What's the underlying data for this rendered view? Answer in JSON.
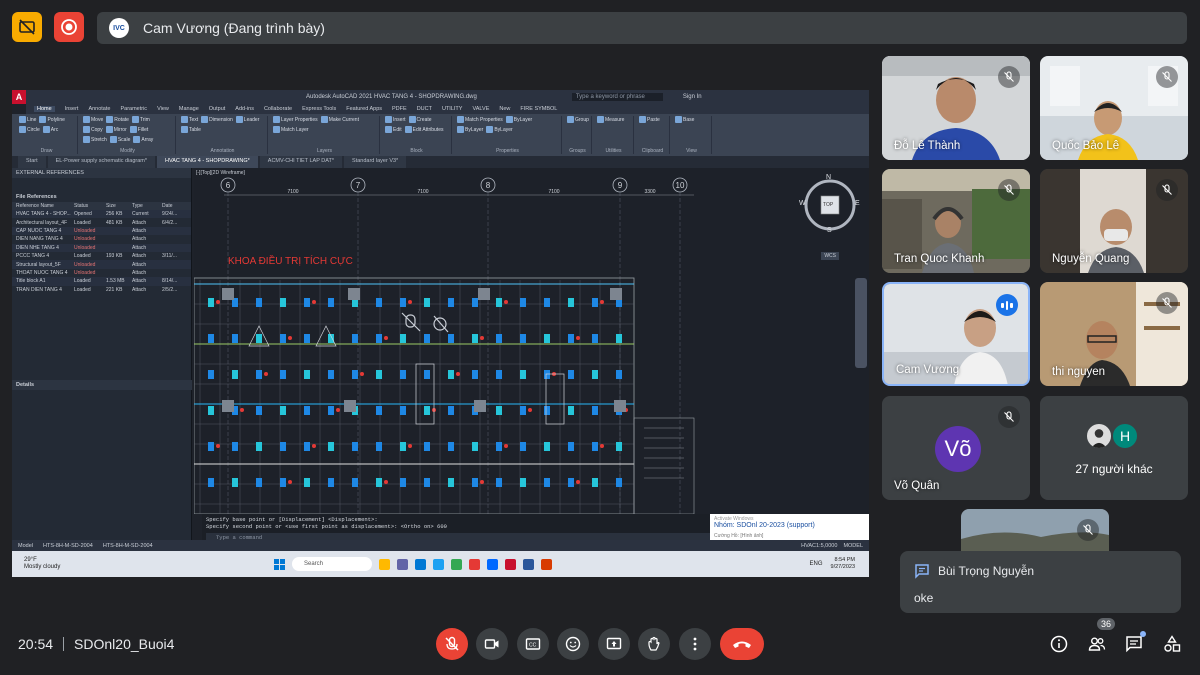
{
  "top": {
    "presenter_initials": "IVC",
    "presenter_text": "Cam Vương (Đang trình bày)"
  },
  "screen": {
    "acad_title": "Autodesk AutoCAD 2021   HVAC TANG 4 - SHOPDRAWING.dwg",
    "acad_search": "Type a keyword or phrase",
    "acad_signin": "Sign In",
    "menu_tabs": [
      "Home",
      "Insert",
      "Annotate",
      "Parametric",
      "View",
      "Manage",
      "Output",
      "Add-ins",
      "Collaborate",
      "Express Tools",
      "Featured Apps",
      "PDFE",
      "DUCT",
      "UTILITY",
      "VALVE",
      "New",
      "FIRE SYMBOL"
    ],
    "ribbon_groups": [
      {
        "label": "Draw",
        "tools": [
          "Line",
          "Polyline",
          "Circle",
          "Arc"
        ]
      },
      {
        "label": "Modify",
        "tools": [
          "Move",
          "Rotate",
          "Trim",
          "Copy",
          "Mirror",
          "Fillet",
          "Stretch",
          "Scale",
          "Array"
        ]
      },
      {
        "label": "Annotation",
        "tools": [
          "Text",
          "Dimension",
          "Leader",
          "Table"
        ]
      },
      {
        "label": "Layers",
        "tools": [
          "Layer Properties",
          "Make Current",
          "Match Layer"
        ]
      },
      {
        "label": "Block",
        "tools": [
          "Insert",
          "Create",
          "Edit",
          "Edit Attributes"
        ]
      },
      {
        "label": "Properties",
        "tools": [
          "Match Properties",
          "ByLayer",
          "ByLayer",
          "ByLayer"
        ]
      },
      {
        "label": "Groups",
        "tools": [
          "Group"
        ]
      },
      {
        "label": "Utilities",
        "tools": [
          "Measure"
        ]
      },
      {
        "label": "Clipboard",
        "tools": [
          "Paste"
        ]
      },
      {
        "label": "View",
        "tools": [
          "Base"
        ]
      }
    ],
    "file_tabs": [
      "Start",
      "EL-Power supply schematic diagram*",
      "HVAC TANG 4 - SHOPDRAWING*",
      "ACMV-CHI TIET LAP DAT*",
      "Standard layer V3*"
    ],
    "xref_title": "EXTERNAL REFERENCES",
    "xref_subtitle": "File References",
    "xref_columns": [
      "Reference Name",
      "Status",
      "Size",
      "Type",
      "Date"
    ],
    "xref_rows": [
      [
        "HVAC TANG 4 - SHOP...",
        "Opened",
        "256 KB",
        "Current",
        "9/24/..."
      ],
      [
        "Architectural layout_4F",
        "Loaded",
        "481 KB",
        "Attach",
        "6/4/2..."
      ],
      [
        "CAP NUOC TANG 4",
        "Unloaded",
        "",
        "Attach",
        ""
      ],
      [
        "DIEN NANG TANG 4",
        "Unloaded",
        "",
        "Attach",
        ""
      ],
      [
        "DIEN NHE TANG 4",
        "Unloaded",
        "",
        "Attach",
        ""
      ],
      [
        "PCCC TANG 4",
        "Loaded",
        "193 KB",
        "Attach",
        "3/11/..."
      ],
      [
        "Structural layout_5F",
        "Unloaded",
        "",
        "Attach",
        ""
      ],
      [
        "THOAT NUOC TANG 4",
        "Unloaded",
        "",
        "Attach",
        ""
      ],
      [
        "Title block A1",
        "Loaded",
        "1.53 MB",
        "Attach",
        "8/14/..."
      ],
      [
        "TRAN DIEN TANG 4",
        "Loaded",
        "221 KB",
        "Attach",
        "2/5/2..."
      ]
    ],
    "details_title": "Details",
    "viewport_label": "[-][Top][2D Wireframe]",
    "grid_numbers": [
      "6",
      "7",
      "8",
      "9",
      "10"
    ],
    "dims": [
      "7100",
      "7100",
      "7100",
      "3300"
    ],
    "red_text": "KHOA ĐIỀU TRỊ TÍCH CỰC",
    "viewcube": {
      "n": "N",
      "e": "E",
      "s": "S",
      "w": "W",
      "top": "TOP",
      "wcs": "WCS"
    },
    "cmd_line1": "Specify base point or [Displacement] <Displacement>:",
    "cmd_line2": "Specify second point or <use first point as displacement>:  <Ortho on> 600",
    "cmd_placeholder": "Type a command",
    "notif_watermark": "Activate Windows",
    "notif_title": "Nhóm: SDOnl 20-2023 (support)",
    "notif_sub": "Cường Hồ: [Hình ảnh]",
    "status_tabs": [
      "Model",
      "HTS-8H-M-SD-2004",
      "HTS-8H-M-SD-2004"
    ],
    "status_scale": "HVAC1:5,0000",
    "status_model": "MODEL",
    "weather_temp": "29°F",
    "weather_text": "Mostly cloudy",
    "search_text": "Search",
    "lang": "ENG",
    "clock_time": "8:54 PM",
    "clock_date": "9/27/2023"
  },
  "participants": [
    {
      "name": "Đỗ Lê Thành"
    },
    {
      "name": "Quốc Bảo Lê"
    },
    {
      "name": "Tran Quoc Khanh"
    },
    {
      "name": "Nguyễn Quang"
    },
    {
      "name": "Cam Vương"
    },
    {
      "name": "thi nguyen"
    },
    {
      "name": "Võ Quân",
      "initials": "Võ"
    },
    {
      "name": "27 người khác",
      "avatar_letter": "H"
    }
  ],
  "chat": {
    "sender": "Bùi Trọng Nguyễn",
    "message": "oke"
  },
  "bottom": {
    "time": "20:54",
    "meeting": "SDOnl20_Buoi4",
    "participant_count": "36"
  },
  "colors": {
    "meet_bg": "#202124",
    "tile_bg": "#3c4043",
    "red": "#ea4335",
    "blue": "#1a73e8",
    "avatar_purple": "#5e35b1",
    "avatar_teal": "#00897b",
    "acad_bg": "#1d2129"
  },
  "icons": [
    "no-captions-icon",
    "record-icon",
    "mic-off-icon",
    "camera-icon",
    "captions-icon",
    "emoji-icon",
    "present-icon",
    "raise-hand-icon",
    "more-icon",
    "hangup-icon",
    "info-icon",
    "people-icon",
    "chat-icon",
    "activities-icon"
  ]
}
